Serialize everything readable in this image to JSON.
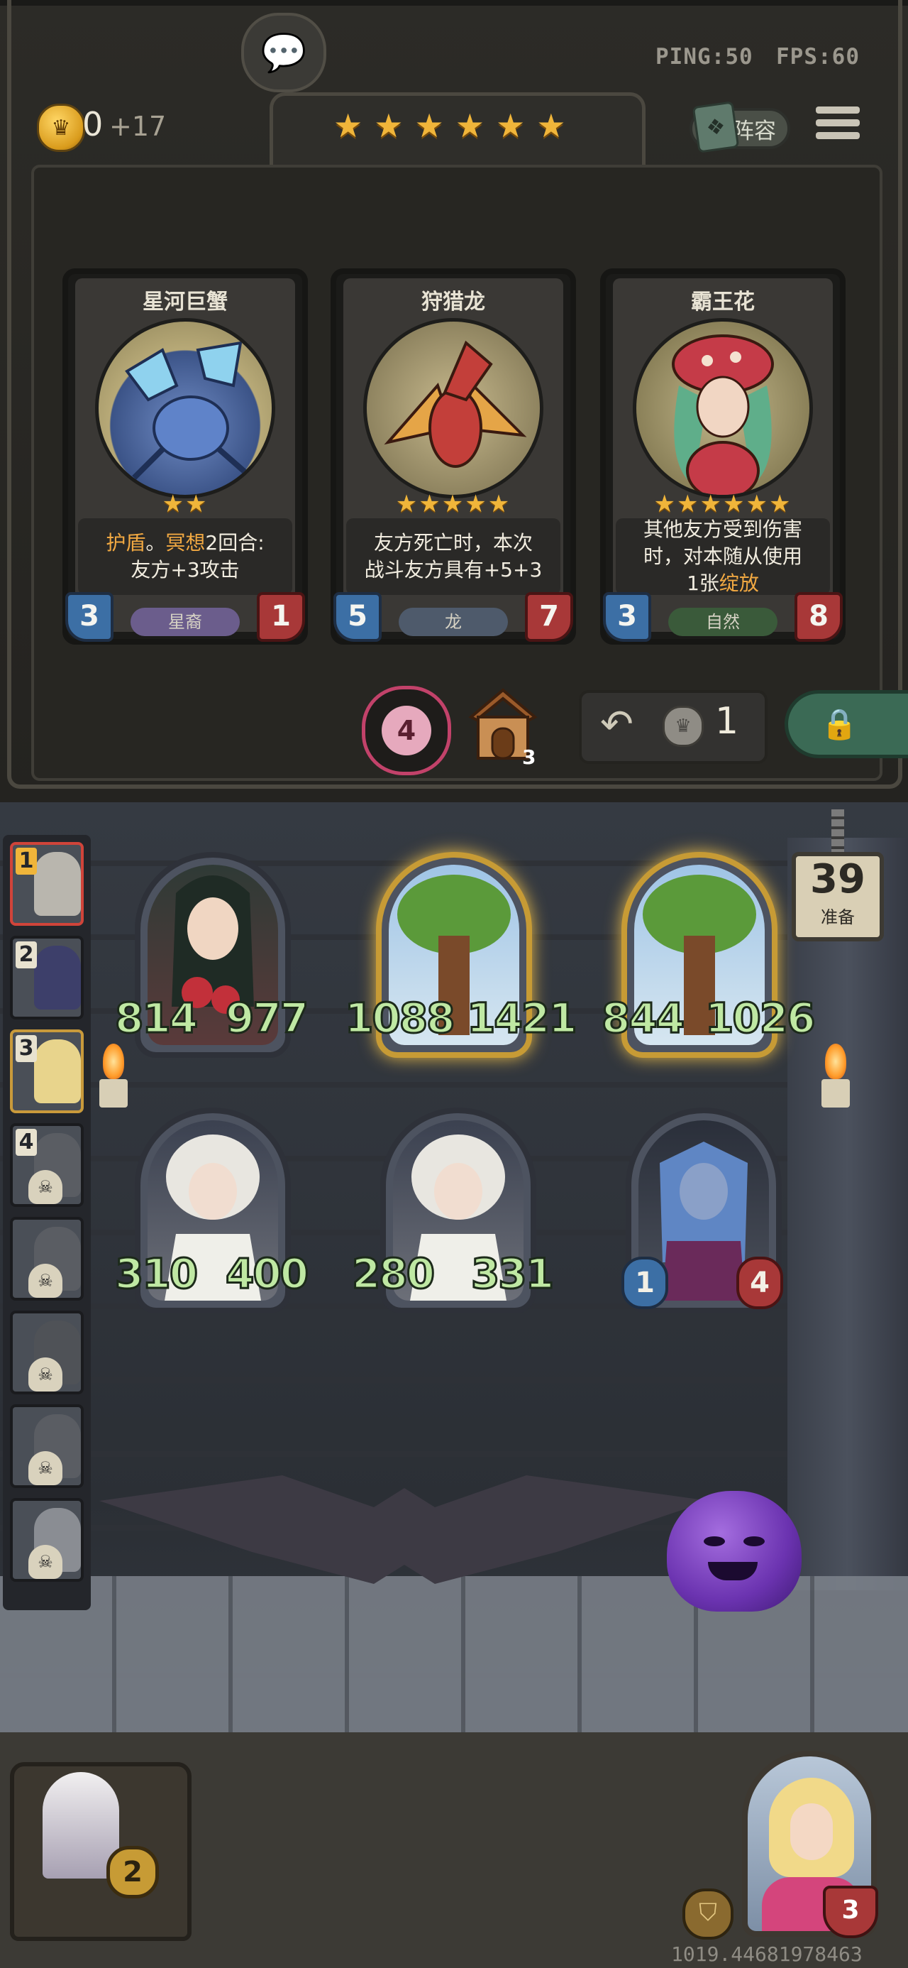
{
  "hud": {
    "ping": "PING:50",
    "fps": "FPS:60"
  },
  "gold": {
    "amount": "0",
    "income": "+17"
  },
  "tavern_stars": 6,
  "top_buttons": {
    "lineup_label": "阵容"
  },
  "shop_cards": [
    {
      "name": "星河巨蟹",
      "stars": "★★",
      "text_parts": [
        [
          "kw",
          "护盾"
        ],
        [
          "n",
          "。"
        ],
        [
          "kw",
          "冥想"
        ],
        [
          "n",
          "2回合:"
        ],
        [
          "br",
          ""
        ],
        [
          "n",
          "友方+3攻击"
        ]
      ],
      "cost": "3",
      "power": "1",
      "tribe": "星裔",
      "tribe_color": "#6b5d8c"
    },
    {
      "name": "狩猎龙",
      "stars": "★★★★★",
      "text_parts": [
        [
          "n",
          "友方死亡时，本次"
        ],
        [
          "br",
          ""
        ],
        [
          "n",
          "战斗友方具有+5+3"
        ]
      ],
      "cost": "5",
      "power": "7",
      "tribe": "龙",
      "tribe_color": "#4e5a6b"
    },
    {
      "name": "霸王花",
      "stars": "★★★★★★",
      "text_parts": [
        [
          "n",
          "其他友方受到伤害"
        ],
        [
          "br",
          ""
        ],
        [
          "n",
          "时，对本随从使用"
        ],
        [
          "br",
          ""
        ],
        [
          "n",
          "1张"
        ],
        [
          "kw",
          "绽放"
        ]
      ],
      "cost": "3",
      "power": "8",
      "tribe": "自然",
      "tribe_color": "#3a5a3a"
    }
  ],
  "shop_controls": {
    "tavern_level": "4",
    "house_count": "3",
    "refresh_cost": "1"
  },
  "ready": {
    "count": "39",
    "label": "准备"
  },
  "players": [
    {
      "rank": "1"
    },
    {
      "rank": "2"
    },
    {
      "rank": "3"
    },
    {
      "rank": "4"
    }
  ],
  "board_front": [
    {
      "attack": "814",
      "health": "977",
      "golden": false
    },
    {
      "attack": "1088",
      "health": "1421",
      "golden": true
    },
    {
      "attack": "844",
      "health": "1026",
      "golden": true
    }
  ],
  "board_back": [
    {
      "attack": "310",
      "health": "400"
    },
    {
      "attack": "280",
      "health": "331"
    },
    {
      "attack": "1",
      "health": "4"
    }
  ],
  "spell": {
    "count": "2"
  },
  "hero": {
    "health": "3"
  },
  "player_id": "1019.44681978463",
  "colors": {
    "star": "#f0b53a",
    "stat_green": "#bfe8a3",
    "health_red": "#a83838",
    "cost_blue": "#3c6fa5"
  }
}
